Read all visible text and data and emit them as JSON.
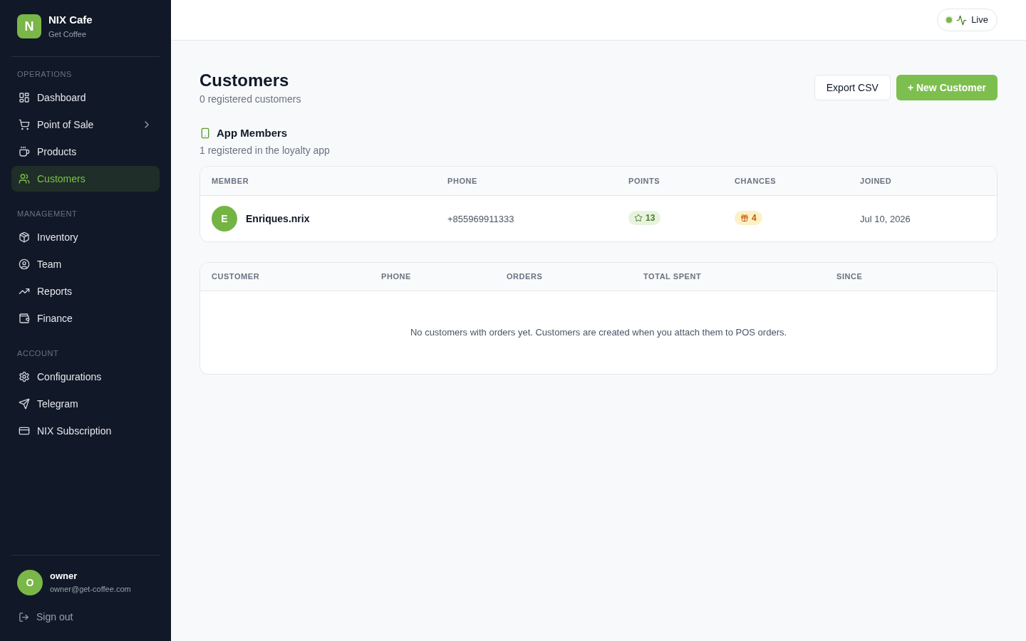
{
  "sidebar": {
    "brand": {
      "initial": "N",
      "name": "NIX Cafe",
      "subtitle": "Get Coffee"
    },
    "sections": [
      {
        "label": "OPERATIONS",
        "items": [
          {
            "label": "Dashboard",
            "selected": false,
            "submenu": false
          },
          {
            "label": "Point of Sale",
            "selected": false,
            "submenu": true
          },
          {
            "label": "Products",
            "selected": false,
            "submenu": false
          },
          {
            "label": "Customers",
            "selected": true,
            "submenu": false
          }
        ]
      },
      {
        "label": "MANAGEMENT",
        "items": [
          {
            "label": "Inventory",
            "selected": false,
            "submenu": false
          },
          {
            "label": "Team",
            "selected": false,
            "submenu": false
          },
          {
            "label": "Reports",
            "selected": false,
            "submenu": false
          },
          {
            "label": "Finance",
            "selected": false,
            "submenu": false
          }
        ]
      },
      {
        "label": "ACCOUNT",
        "items": [
          {
            "label": "Configurations",
            "selected": false,
            "submenu": false
          },
          {
            "label": "Telegram",
            "selected": false,
            "submenu": false
          },
          {
            "label": "NIX Subscription",
            "selected": false,
            "submenu": false
          }
        ]
      }
    ],
    "user": {
      "initial": "O",
      "name": "owner",
      "email": "owner@get-coffee.com"
    },
    "sign_out": "Sign out"
  },
  "header": {
    "status": {
      "label": "Live",
      "online": true
    }
  },
  "page": {
    "title": "Customers",
    "subtitle": "0 registered customers",
    "actions": [
      {
        "label": "Export CSV",
        "kind": "secondary"
      },
      {
        "label": "+ New Customer",
        "kind": "primary"
      }
    ]
  },
  "app_members": {
    "title": "App Members",
    "subtitle": "1 registered in the loyalty app",
    "table": {
      "columns": [
        "MEMBER",
        "PHONE",
        "POINTS",
        "CHANCES",
        "JOINED"
      ],
      "rows": [
        {
          "initial": "E",
          "member": "Enriques.nrix",
          "phone": "+855969911333",
          "points": "13",
          "chances": "4",
          "joined": "Jul 10, 2026"
        }
      ]
    }
  },
  "customers_table": {
    "columns": [
      "CUSTOMER",
      "PHONE",
      "ORDERS",
      "TOTAL SPENT",
      "SINCE"
    ],
    "empty_message": "No customers with orders yet. Customers are created when you attach them to POS orders."
  }
}
